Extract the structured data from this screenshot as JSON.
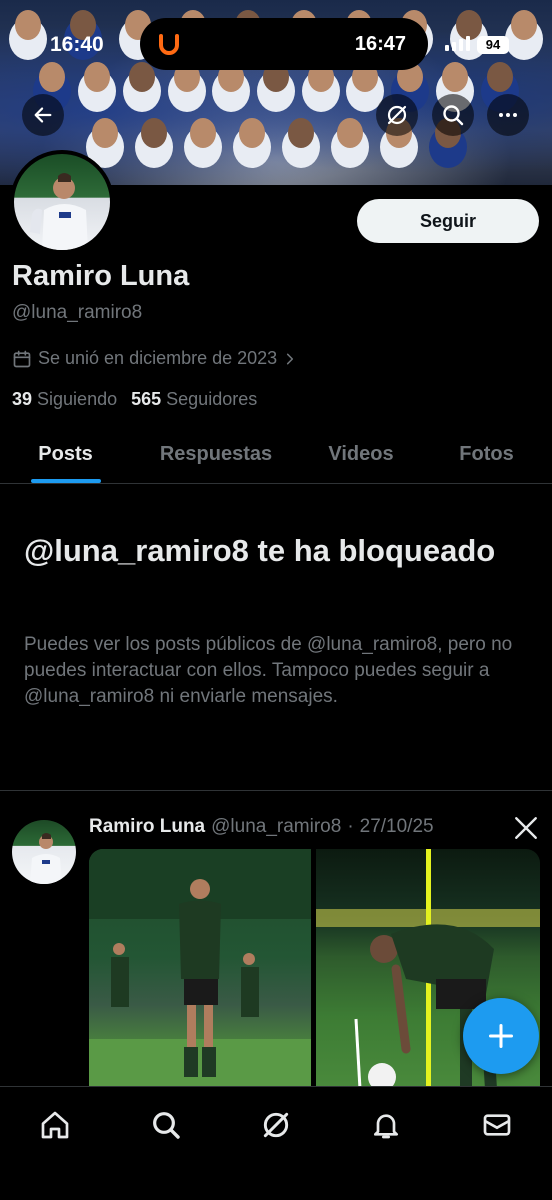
{
  "status_bar": {
    "time_left": "16:40",
    "time_right": "16:47",
    "battery": "94"
  },
  "header_actions": {
    "back_icon": "arrow-left-icon",
    "grok_icon": "grok-icon",
    "search_icon": "search-icon",
    "more_icon": "more-icon"
  },
  "profile": {
    "follow_label": "Seguir",
    "name": "Ramiro Luna",
    "handle": "@luna_ramiro8",
    "joined": "Se unió en diciembre de 2023",
    "following_count": "39",
    "following_label": "Siguiendo",
    "followers_count": "565",
    "followers_label": "Seguidores"
  },
  "tabs": [
    {
      "label": "Posts",
      "active": true
    },
    {
      "label": "Respuestas",
      "active": false
    },
    {
      "label": "Videos",
      "active": false
    },
    {
      "label": "Fotos",
      "active": false
    }
  ],
  "blocked": {
    "title": "@luna_ramiro8 te ha bloqueado",
    "description": "Puedes ver los posts públicos de @luna_ramiro8, pero no puedes interactuar con ellos. Tampoco puedes seguir a @luna_ramiro8 ni enviarle mensajes."
  },
  "post": {
    "author": "Ramiro Luna",
    "handle": "@luna_ramiro8",
    "separator": "·",
    "date": "27/10/25"
  },
  "bottom_nav": [
    "home-icon",
    "search-icon",
    "grok-icon",
    "notifications-icon",
    "messages-icon"
  ],
  "colors": {
    "accent": "#1d9bf0",
    "background": "#000000",
    "secondary_text": "#71767b"
  }
}
